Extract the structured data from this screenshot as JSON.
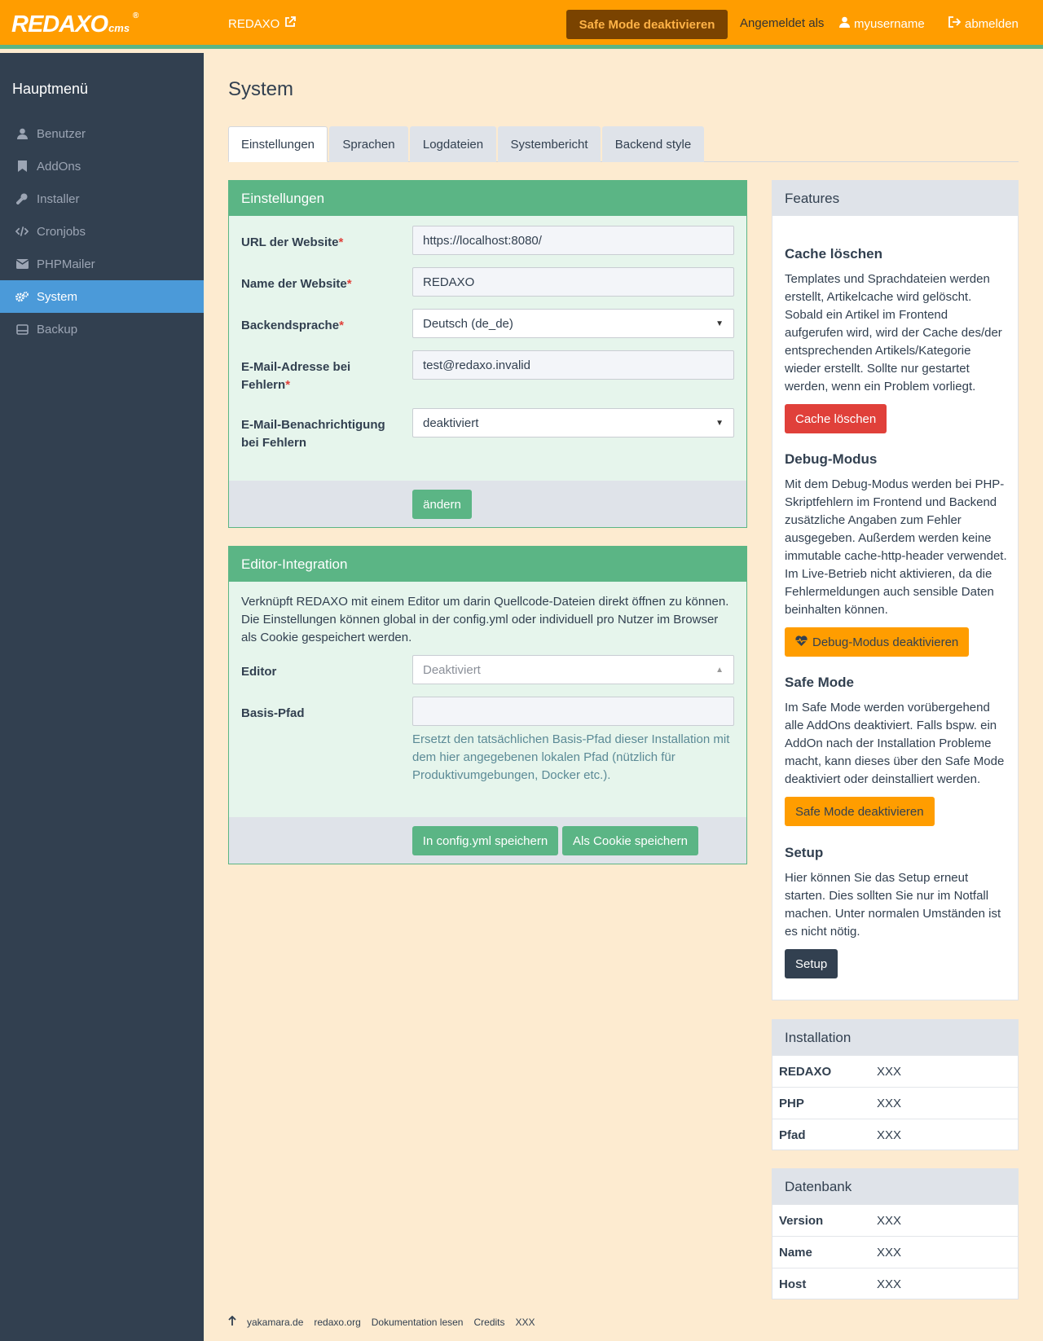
{
  "header": {
    "logo_text": "REDAXO",
    "logo_cms": "cms",
    "logo_reg": "®",
    "site_link": "REDAXO",
    "safe_mode_button": "Safe Mode deaktivieren",
    "logged_in_as": "Angemeldet als",
    "username": "myusername",
    "logout": "abmelden"
  },
  "sidebar": {
    "title": "Hauptmenü",
    "items": [
      {
        "label": "Benutzer",
        "icon": "user-icon"
      },
      {
        "label": "AddOns",
        "icon": "bookmark-icon"
      },
      {
        "label": "Installer",
        "icon": "wrench-icon"
      },
      {
        "label": "Cronjobs",
        "icon": "code-icon"
      },
      {
        "label": "PHPMailer",
        "icon": "envelope-icon"
      },
      {
        "label": "System",
        "icon": "cogs-icon",
        "active": true
      },
      {
        "label": "Backup",
        "icon": "hdd-icon"
      }
    ]
  },
  "page": {
    "title": "System"
  },
  "tabs": [
    "Einstellungen",
    "Sprachen",
    "Logdateien",
    "Systembericht",
    "Backend style"
  ],
  "settings": {
    "title": "Einstellungen",
    "url_label": "URL der Website",
    "url_value": "https://localhost:8080/",
    "name_label": "Name der Website",
    "name_value": "REDAXO",
    "lang_label": "Backendsprache",
    "lang_value": "Deutsch (de_de)",
    "email_label": "E-Mail-Adresse bei Fehlern",
    "email_value": "test@redaxo.invalid",
    "notify_label": "E-Mail-Benachrichtigung bei Fehlern",
    "notify_value": "deaktiviert",
    "required_mark": "*",
    "submit": "ändern"
  },
  "editor": {
    "title": "Editor-Integration",
    "intro": "Verknüpft REDAXO mit einem Editor um darin Quellcode-Dateien direkt öffnen zu können. Die Einstellungen können global in der config.yml oder individuell pro Nutzer im Browser als Cookie gespeichert werden.",
    "editor_label": "Editor",
    "editor_value": "Deaktiviert",
    "path_label": "Basis-Pfad",
    "path_value": "",
    "path_help": "Ersetzt den tatsächlichen Basis-Pfad dieser Installation mit dem hier angegebenen lokalen Pfad (nützlich für Produktivumgebungen, Docker etc.).",
    "save_config": "In config.yml speichern",
    "save_cookie": "Als Cookie speichern"
  },
  "features": {
    "title": "Features",
    "cache_title": "Cache löschen",
    "cache_text": "Templates und Sprachdateien werden erstellt, Artikelcache wird gelöscht. Sobald ein Artikel im Frontend aufgerufen wird, wird der Cache des/der entsprechenden Artikels/Kategorie wieder erstellt. Sollte nur gestartet werden, wenn ein Problem vorliegt.",
    "cache_button": "Cache löschen",
    "debug_title": "Debug-Modus",
    "debug_text": "Mit dem Debug-Modus werden bei PHP-Skriptfehlern im Frontend und Backend zusätzliche Angaben zum Fehler ausgegeben. Außerdem werden keine immutable cache-http-header verwendet. Im Live-Betrieb nicht aktivieren, da die Fehlermeldungen auch sensible Daten beinhalten können.",
    "debug_button": "Debug-Modus deaktivieren",
    "safe_title": "Safe Mode",
    "safe_text": "Im Safe Mode werden vorübergehend alle AddOns deaktiviert. Falls bspw. ein AddOn nach der Installation Probleme macht, kann dieses über den Safe Mode deaktiviert oder deinstalliert werden.",
    "safe_button": "Safe Mode deaktivieren",
    "setup_title": "Setup",
    "setup_text": "Hier können Sie das Setup erneut starten. Dies sollten Sie nur im Notfall machen. Unter normalen Umständen ist es nicht nötig.",
    "setup_button": "Setup"
  },
  "installation": {
    "title": "Installation",
    "rows": [
      {
        "key": "REDAXO",
        "value": "XXX"
      },
      {
        "key": "PHP",
        "value": "XXX"
      },
      {
        "key": "Pfad",
        "value": "XXX"
      }
    ]
  },
  "database": {
    "title": "Datenbank",
    "rows": [
      {
        "key": "Version",
        "value": "XXX"
      },
      {
        "key": "Name",
        "value": "XXX"
      },
      {
        "key": "Host",
        "value": "XXX"
      }
    ]
  },
  "footer": {
    "links": [
      "yakamara.de",
      "redaxo.org",
      "Dokumentation lesen",
      "Credits",
      "XXX"
    ]
  },
  "colors": {
    "header": "#ff9d00",
    "sidebar": "#324050",
    "active_nav": "#4b9ad9",
    "success": "#5bb585",
    "danger": "#e0403a",
    "background": "#fdebd0"
  }
}
